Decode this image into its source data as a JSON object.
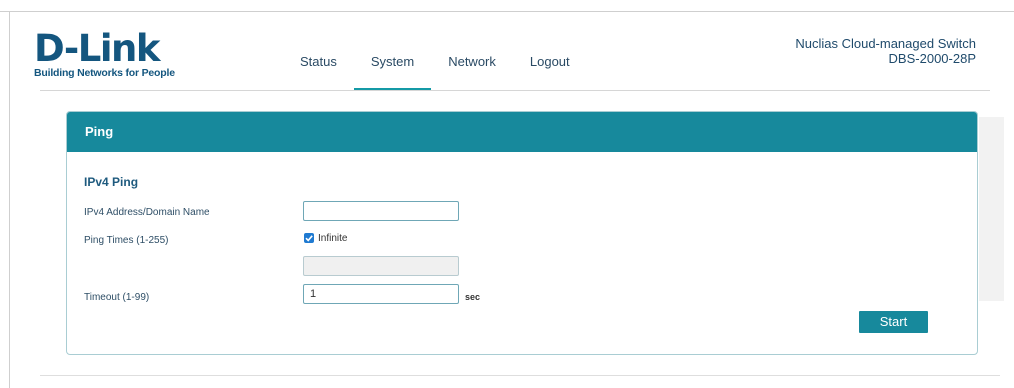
{
  "logo": {
    "brand": "D-Link",
    "tagline": "Building Networks for People"
  },
  "nav": {
    "items": [
      {
        "label": "Status"
      },
      {
        "label": "System",
        "active": true
      },
      {
        "label": "Network"
      },
      {
        "label": "Logout"
      }
    ]
  },
  "device": {
    "title": "Nuclias Cloud-managed Switch",
    "model": "DBS-2000-28P"
  },
  "panel": {
    "title": "Ping",
    "section_title": "IPv4 Ping",
    "address": {
      "label": "IPv4 Address/Domain Name",
      "value": ""
    },
    "ping_times": {
      "label": "Ping Times (1-255)",
      "infinite_label": "Infinite",
      "infinite_checked": true,
      "value": ""
    },
    "timeout": {
      "label": "Timeout (1-99)",
      "value": "1",
      "unit": "sec"
    },
    "start_label": "Start"
  },
  "colors": {
    "accent": "#17899c",
    "brand": "#14567f"
  }
}
